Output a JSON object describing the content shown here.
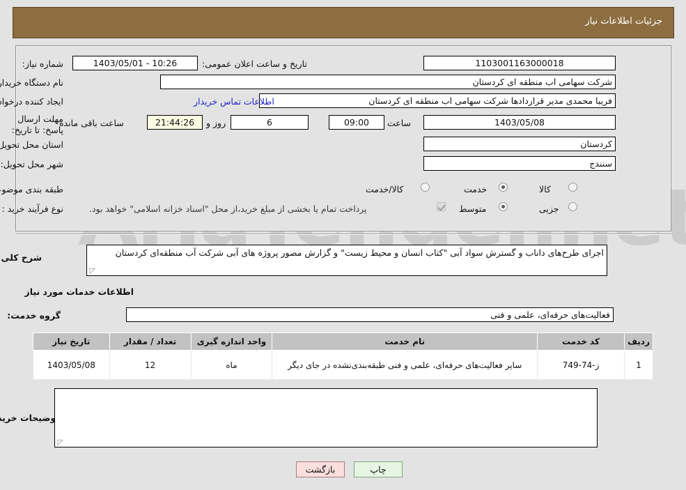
{
  "header": {
    "title": "جزئیات اطلاعات نیاز"
  },
  "form": {
    "need_number_label": "شماره نیاز:",
    "need_number_value": "1103001163000018",
    "announce_label": "تاریخ و ساعت اعلان عمومی:",
    "announce_value": "1403/05/01 - 10:26",
    "buyer_org_label": "نام دستگاه خریدار:",
    "buyer_org_value": "شرکت سهامی اب منطقه ای کردستان",
    "creator_label": "ایجاد کننده درخواست:",
    "creator_value": "فریبا محمدی مدیر قراردادها شرکت سهامی اب منطقه ای کردستان",
    "contact_link": "اطلاعات تماس خریدار",
    "deadline_label": "مهلت ارسال پاسخ: تا تاریخ:",
    "deadline_date": "1403/05/08",
    "hour_label": "ساعت",
    "deadline_time": "09:00",
    "days_value": "6",
    "days_label": "روز و",
    "countdown_value": "21:44:26",
    "remaining_label": "ساعت باقی مانده",
    "province_label": "استان محل تحویل:",
    "province_value": "کردستان",
    "city_label": "شهر محل تحویل:",
    "city_value": "سنندج",
    "category_label": "طبقه بندی موضوعی:",
    "category_options": [
      {
        "label": "کالا",
        "selected": false
      },
      {
        "label": "خدمت",
        "selected": true
      },
      {
        "label": "کالا/خدمت",
        "selected": false
      }
    ],
    "process_label": "نوع فرآیند خرید :",
    "process_options": [
      {
        "label": "جزیی",
        "selected": false
      },
      {
        "label": "متوسط",
        "selected": true
      }
    ],
    "treasury_checkbox_checked": true,
    "treasury_note": "پرداخت تمام یا بخشی از مبلغ خرید،از محل \"اسناد خزانه اسلامی\" خواهد بود."
  },
  "description": {
    "label": "شرح کلی نیاز:",
    "value": "اجرای طرح‌های داناب و گسترش سواد آبی \"کتاب انسان و محیط زیست\" و گزارش مصور پروژه های آبی شرکت آب منطقه‌ای کردستان"
  },
  "services": {
    "section_title": "اطلاعات خدمات مورد نیاز",
    "group_label": "گروه خدمت:",
    "group_value": "فعالیت‌های حرفه‌ای، علمی و فنی",
    "columns": [
      "ردیف",
      "کد خدمت",
      "نام خدمت",
      "واحد اندازه گیری",
      "تعداد / مقدار",
      "تاریخ نیاز"
    ],
    "rows": [
      {
        "index": "1",
        "code": "ز-74-749",
        "name": "سایر فعالیت‌های حرفه‌ای، علمی و فنی طبقه‌بندی‌نشده در جای دیگر",
        "unit": "ماه",
        "qty": "12",
        "date": "1403/05/08"
      }
    ]
  },
  "buyer_notes": {
    "label": "توضیحات خریدار:",
    "value": ""
  },
  "footer": {
    "print_label": "چاپ",
    "back_label": "بازگشت"
  },
  "watermark": {
    "text": "AriaTender.net"
  },
  "colors": {
    "header_bar": "#8d6e41",
    "page_bg": "#e3e3e3",
    "table_header": "#c2c2c2",
    "link": "#2222cc",
    "timer_bg": "#fbfbe3",
    "print_btn": "#e7f6e4",
    "back_btn": "#fbdede"
  }
}
